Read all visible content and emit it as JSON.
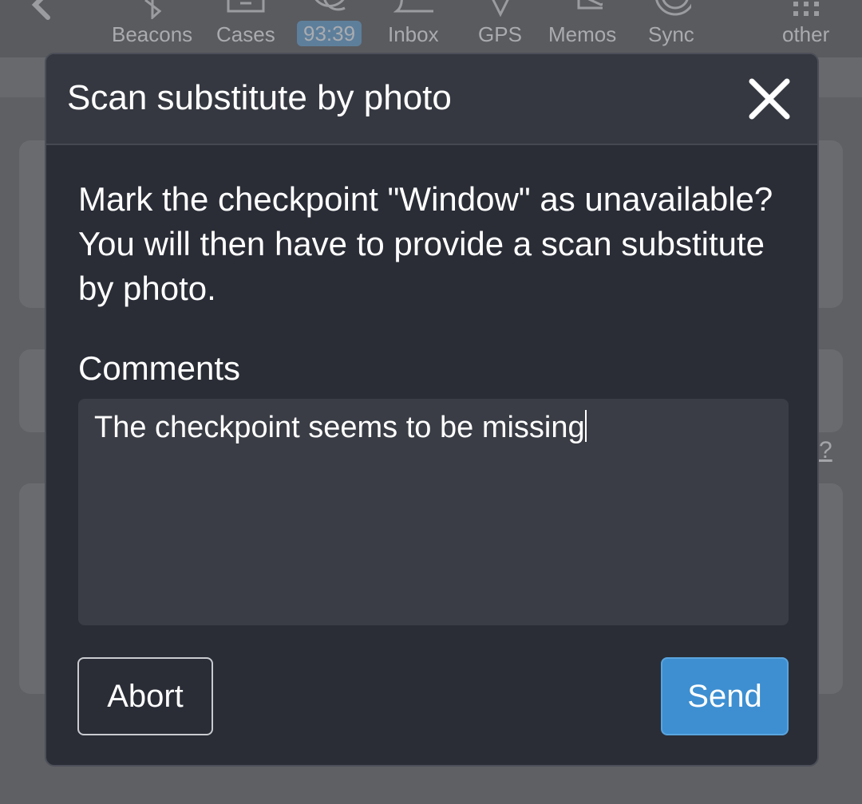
{
  "toolbar": {
    "items": [
      {
        "label": "Beacons",
        "icon": "bluetooth-icon"
      },
      {
        "label": "Cases",
        "icon": "case-icon"
      },
      {
        "label": "93:39",
        "icon": "timer-icon"
      },
      {
        "label": "Inbox",
        "icon": "bell-icon"
      },
      {
        "label": "GPS",
        "icon": "location-icon"
      },
      {
        "label": "Memos",
        "icon": "mail-icon"
      },
      {
        "label": "Sync",
        "icon": "sync-icon"
      },
      {
        "label": "other",
        "icon": "grid-icon"
      }
    ]
  },
  "background": {
    "help_link": "?"
  },
  "modal": {
    "title": "Scan substitute by photo",
    "message": "Mark the checkpoint \"Window\" as unavailable? You will then have to provide a scan substitute by photo.",
    "comments_label": "Comments",
    "comments_value": "The checkpoint seems to be missing",
    "abort_label": "Abort",
    "send_label": "Send"
  },
  "colors": {
    "modal_background": "#2a2d36",
    "header_background": "#353840",
    "send_button": "#3d8fd1",
    "timer_badge": "#5e7f9b"
  }
}
